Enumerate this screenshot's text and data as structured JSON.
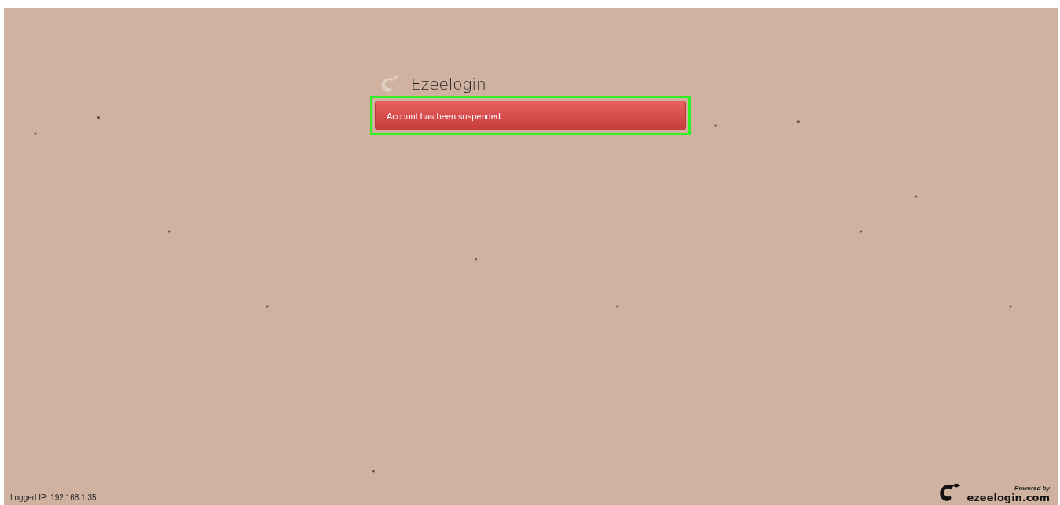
{
  "header": {
    "title": "Ezeelogin"
  },
  "alert": {
    "message": "Account has been suspended",
    "highlighted": true
  },
  "footer": {
    "logged_ip": "Logged IP: 192.168.1.35",
    "powered_by": "Powered by",
    "brand": "ezeelogin.com"
  }
}
